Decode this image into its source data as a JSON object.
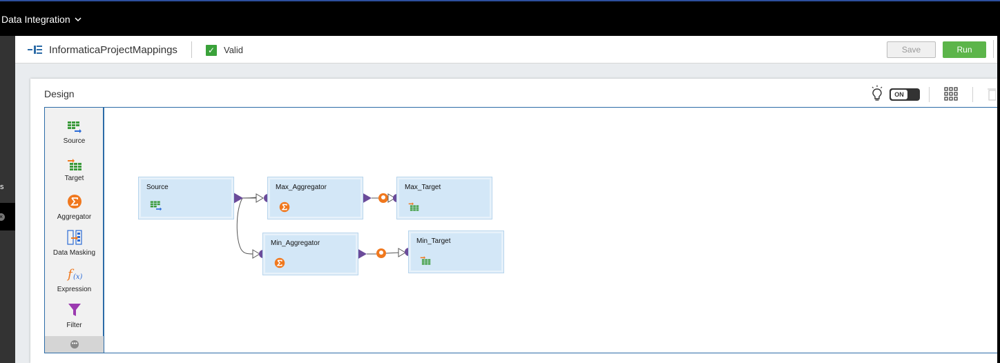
{
  "topbar": {
    "app_name": "Data Integration"
  },
  "leftrail": {
    "partial_text": "s"
  },
  "header": {
    "mapping_name": "InformaticaProjectMappings",
    "status": "Valid",
    "save_label": "Save",
    "run_label": "Run"
  },
  "design": {
    "title": "Design",
    "toggle_label": "ON"
  },
  "palette": {
    "items": [
      {
        "label": "Source",
        "icon": "source-icon"
      },
      {
        "label": "Target",
        "icon": "target-icon"
      },
      {
        "label": "Aggregator",
        "icon": "aggregator-icon"
      },
      {
        "label": "Data Masking",
        "icon": "data-masking-icon"
      },
      {
        "label": "Expression",
        "icon": "expression-icon"
      },
      {
        "label": "Filter",
        "icon": "filter-icon"
      }
    ]
  },
  "nodes": {
    "source": {
      "name": "Source",
      "icon": "source-icon"
    },
    "max_aggregator": {
      "name": "Max_Aggregator",
      "icon": "aggregator-icon"
    },
    "max_target": {
      "name": "Max_Target",
      "icon": "target-icon"
    },
    "min_aggregator": {
      "name": "Min_Aggregator",
      "icon": "aggregator-icon"
    },
    "min_target": {
      "name": "Min_Target",
      "icon": "target-icon"
    }
  },
  "colors": {
    "accent_green": "#5cb54a",
    "node_fill": "#d3e7f7",
    "port_purple": "#6b4b9a",
    "aggregator_orange": "#f0781e",
    "link_blue": "#2a6aa6"
  }
}
